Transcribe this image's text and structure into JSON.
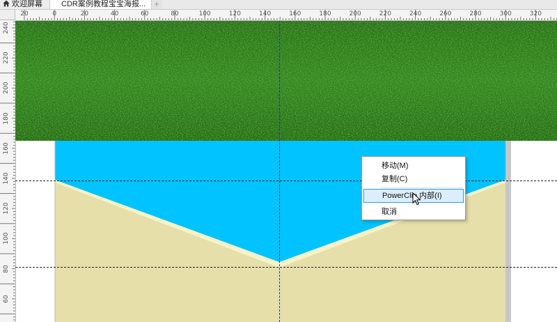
{
  "tabs": [
    {
      "label": "欢迎屏幕",
      "icon": "home-icon",
      "active": false
    },
    {
      "label": "CDR案例教程宝宝海报...",
      "active": true
    }
  ],
  "new_tab_label": "+",
  "ruler_top_labels": [
    "20",
    "0",
    "20",
    "40",
    "60",
    "80",
    "100",
    "120",
    "140",
    "160",
    "180",
    "200",
    "220",
    "240",
    "260",
    "280",
    "300",
    "320"
  ],
  "ruler_left_labels": [
    "240",
    "220",
    "200",
    "180",
    "160",
    "140",
    "120",
    "100",
    "80",
    "60"
  ],
  "context_menu": {
    "items": [
      {
        "label": "移动(M)",
        "highlighted": false
      },
      {
        "label": "复制(C)",
        "highlighted": false
      },
      {
        "label": "PowerClip 内部(I)",
        "highlighted": true
      },
      {
        "label": "取消",
        "highlighted": false
      }
    ]
  },
  "colors": {
    "sky": "#00c3ff",
    "sand": "#e6dfaa",
    "sand_highlight": "#f6f3c6",
    "grass": "#3f9a24",
    "menu_highlight": "#dbeefb"
  }
}
